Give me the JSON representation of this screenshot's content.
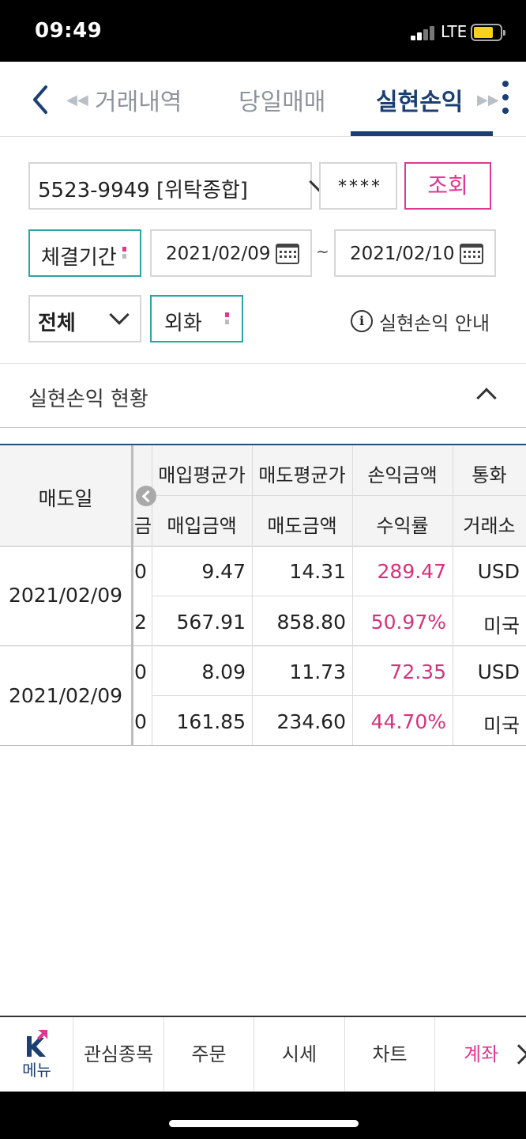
{
  "status_bar": {
    "time": "09:49",
    "network": "LTE"
  },
  "tabs": [
    {
      "label": "거래내역",
      "active": false
    },
    {
      "label": "당일매매",
      "active": false
    },
    {
      "label": "실현손익",
      "active": true
    }
  ],
  "form": {
    "account": "5523-9949 [위탁종합]",
    "password_mask": "****",
    "query_label": "조회",
    "period_label": "체결기간",
    "date_from": "2021/02/09",
    "date_separator": "~",
    "date_to": "2021/02/10",
    "filter_value": "전체",
    "currency_label": "외화",
    "info_label": "실현손익 안내"
  },
  "section": {
    "title": "실현손익 현황"
  },
  "table": {
    "frozen_header": "매도일",
    "header_row1": [
      "매입평균가",
      "매도평균가",
      "손익금액",
      "통화"
    ],
    "header_row2_partial": "금",
    "header_row2": [
      "매입금액",
      "매도금액",
      "수익률",
      "거래소"
    ],
    "records": [
      {
        "sell_date": "2021/02/09",
        "row1_partial": "0",
        "row1": [
          "9.47",
          "14.31",
          "289.47",
          "USD"
        ],
        "row2_partial": "2",
        "row2": [
          "567.91",
          "858.80",
          "50.97%",
          "미국"
        ]
      },
      {
        "sell_date": "2021/02/09",
        "row1_partial": "0",
        "row1": [
          "8.09",
          "11.73",
          "72.35",
          "USD"
        ],
        "row2_partial": "0",
        "row2": [
          "161.85",
          "234.60",
          "44.70%",
          "미국"
        ]
      }
    ]
  },
  "bottom_nav": {
    "menu_label": "메뉴",
    "items": [
      "관심종목",
      "주문",
      "시세",
      "차트",
      "계좌"
    ],
    "active_item": "계좌"
  },
  "colors": {
    "accent_navy": "#1c3f73",
    "accent_pink": "#e0388f",
    "teal_border": "#2aa4a4",
    "profit_pink": "#d8317c"
  },
  "icons": [
    "back-icon",
    "double-left-arrow-icon",
    "double-right-arrow-icon",
    "kebab-menu-icon",
    "chevron-down-icon",
    "calendar-icon",
    "info-icon",
    "chevron-up-icon",
    "scroll-left-icon",
    "k-logo-icon",
    "chevron-right-icon"
  ]
}
